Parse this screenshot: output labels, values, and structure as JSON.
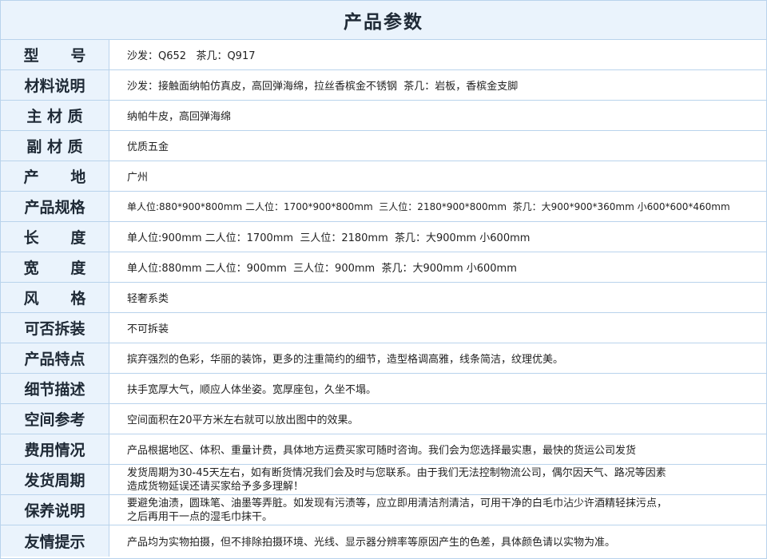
{
  "title": "产品参数",
  "rows": [
    {
      "label": "型      号",
      "value": "沙发：Q652   茶几：Q917"
    },
    {
      "label": "材料说明",
      "value": "沙发：接触面纳帕仿真皮，高回弹海绵，拉丝香槟金不锈钢  茶几：岩板，香槟金支脚"
    },
    {
      "label": "主 材 质",
      "value": "纳帕牛皮，高回弹海绵"
    },
    {
      "label": "副 材 质",
      "value": "优质五金"
    },
    {
      "label": "产      地",
      "value": "广州"
    },
    {
      "label": "产品规格",
      "value": "单人位:880*900*800mm 二人位：1700*900*800mm  三人位：2180*900*800mm  茶几：大900*900*360mm 小600*600*460mm"
    },
    {
      "label": "长      度",
      "value": "单人位:900mm 二人位：1700mm  三人位：2180mm  茶几：大900mm 小600mm"
    },
    {
      "label": "宽      度",
      "value": "单人位:880mm 二人位：900mm  三人位：900mm  茶几：大900mm 小600mm"
    },
    {
      "label": "风      格",
      "value": "轻奢系类"
    },
    {
      "label": "可否拆装",
      "value": "不可拆装"
    },
    {
      "label": "产品特点",
      "value": "摈弃强烈的色彩，华丽的装饰，更多的注重简约的细节，造型格调高雅，线条简洁，纹理优美。"
    },
    {
      "label": "细节描述",
      "value": "扶手宽厚大气，顺应人体坐姿。宽厚座包，久坐不塌。"
    },
    {
      "label": "空间参考",
      "value": "空间面积在20平方米左右就可以放出图中的效果。"
    },
    {
      "label": "费用情况",
      "value": "产品根据地区、体积、重量计费，具体地方运费买家可随时咨询。我们会为您选择最实惠，最快的货运公司发货"
    },
    {
      "label": "发货周期",
      "value": "发货周期为30-45天左右，如有断货情况我们会及时与您联系。由于我们无法控制物流公司，偶尔因天气、路况等因素\n造成货物延误还请买家给予多多理解！"
    },
    {
      "label": "保养说明",
      "value": "要避免油渍，圆珠笔、油墨等弄脏。如发现有污渍等，应立即用清洁剂清洁，可用干净的白毛巾沾少许酒精轻抹污点，\n之后再用干一点的湿毛巾抹干。"
    },
    {
      "label": "友情提示",
      "value": "产品均为实物拍摄，但不排除拍摄环境、光线、显示器分辨率等原因产生的色差，具体颜色请以实物为准。"
    }
  ]
}
